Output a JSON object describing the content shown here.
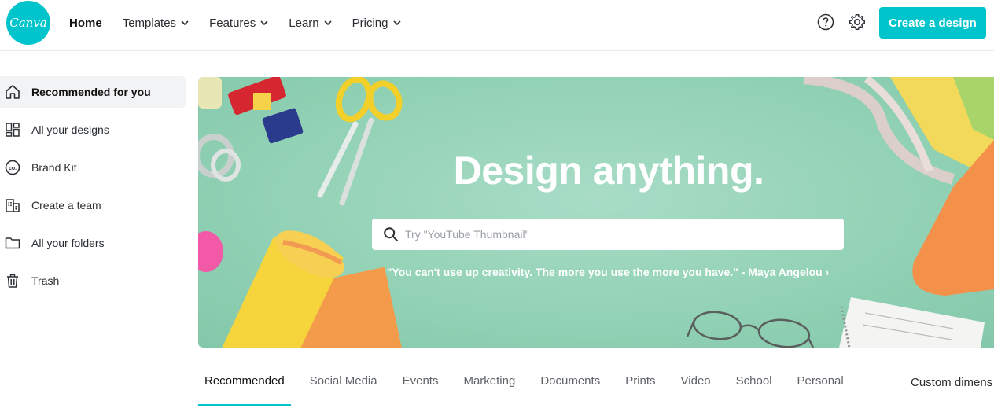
{
  "brand": {
    "logo_text": "Canva",
    "accent": "#00c4cc"
  },
  "nav": {
    "items": [
      {
        "label": "Home",
        "dropdown": false
      },
      {
        "label": "Templates",
        "dropdown": true
      },
      {
        "label": "Features",
        "dropdown": true
      },
      {
        "label": "Learn",
        "dropdown": true
      },
      {
        "label": "Pricing",
        "dropdown": true
      }
    ],
    "help_icon": "question-circle-icon",
    "settings_icon": "gear-icon",
    "cta_label": "Create a design"
  },
  "sidebar": {
    "items": [
      {
        "label": "Recommended for you",
        "icon": "home-icon",
        "active": true
      },
      {
        "label": "All your designs",
        "icon": "grid-icon",
        "active": false
      },
      {
        "label": "Brand Kit",
        "icon": "brand-kit-icon",
        "active": false
      },
      {
        "label": "Create a team",
        "icon": "team-building-icon",
        "active": false
      },
      {
        "label": "All your folders",
        "icon": "folder-icon",
        "active": false
      },
      {
        "label": "Trash",
        "icon": "trash-icon",
        "active": false
      }
    ]
  },
  "hero": {
    "title": "Design anything.",
    "search_placeholder": "Try \"YouTube Thumbnail\"",
    "quote": "\"You can't use up creativity. The more you use the more you have.\" - Maya Angelou ›"
  },
  "tabs": {
    "items": [
      "Recommended",
      "Social Media",
      "Events",
      "Marketing",
      "Documents",
      "Prints",
      "Video",
      "School",
      "Personal"
    ],
    "active_index": 0,
    "custom_label": "Custom dimens"
  }
}
